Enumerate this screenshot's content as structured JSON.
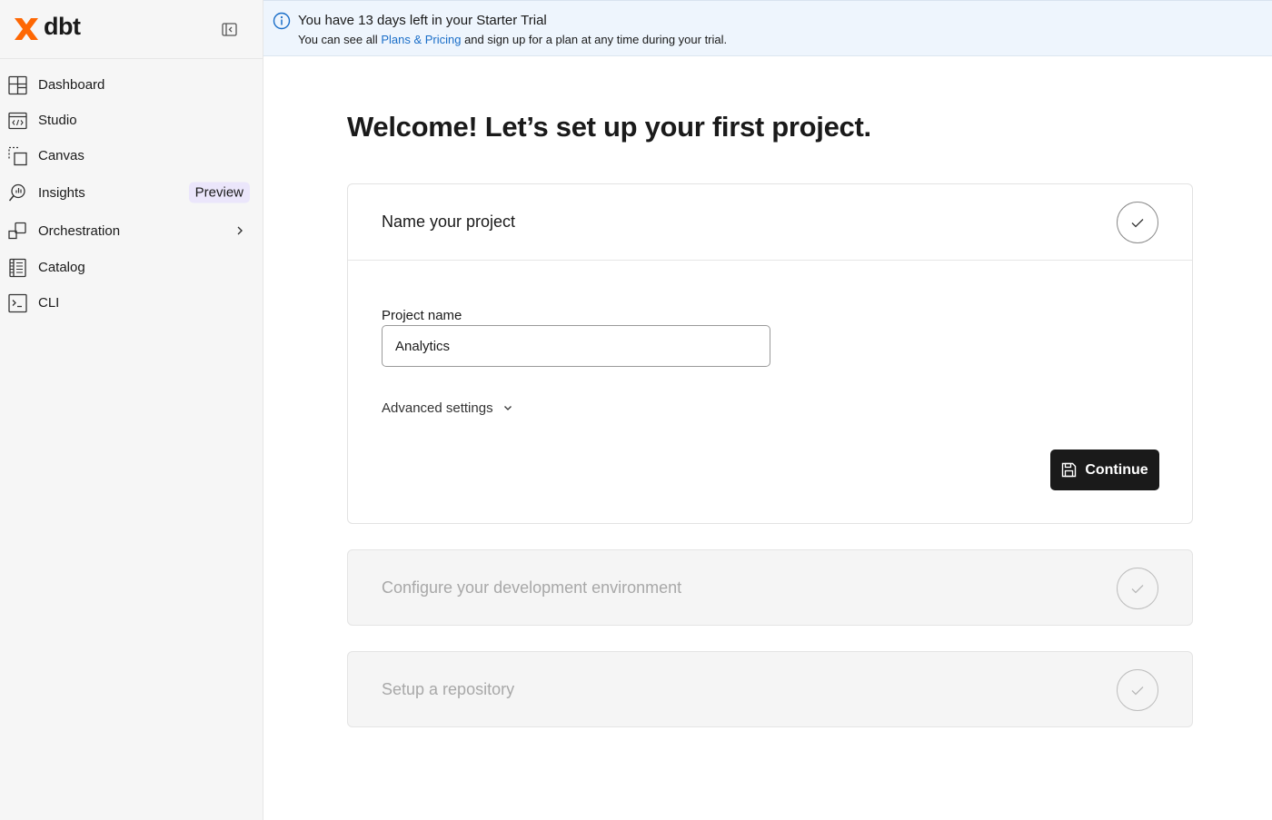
{
  "sidebar": {
    "brand": "dbt",
    "items": [
      {
        "label": "Dashboard",
        "icon": "dashboard-icon"
      },
      {
        "label": "Studio",
        "icon": "code-window-icon"
      },
      {
        "label": "Canvas",
        "icon": "canvas-icon"
      },
      {
        "label": "Insights",
        "icon": "insights-icon",
        "badge": "Preview"
      },
      {
        "label": "Orchestration",
        "icon": "orchestration-icon"
      },
      {
        "label": "Catalog",
        "icon": "catalog-icon"
      },
      {
        "label": "CLI",
        "icon": "terminal-icon"
      }
    ]
  },
  "banner": {
    "title": "You have 13 days left in your Starter Trial",
    "text_before": "You can see all ",
    "link": "Plans & Pricing",
    "text_after": " and sign up for a plan at any time during your trial."
  },
  "main": {
    "title": "Welcome! Let’s set up your first project.",
    "steps": [
      {
        "title": "Name your project",
        "field_label": "Project name",
        "field_value": "Analytics",
        "advanced_label": "Advanced settings",
        "continue_label": "Continue"
      },
      {
        "title": "Configure your development environment"
      },
      {
        "title": "Setup a repository"
      }
    ]
  },
  "colors": {
    "brand_orange": "#fe6703",
    "banner_bg": "#eef5fd",
    "link": "#1a6ec8",
    "badge_bg": "#ebe6fb"
  }
}
